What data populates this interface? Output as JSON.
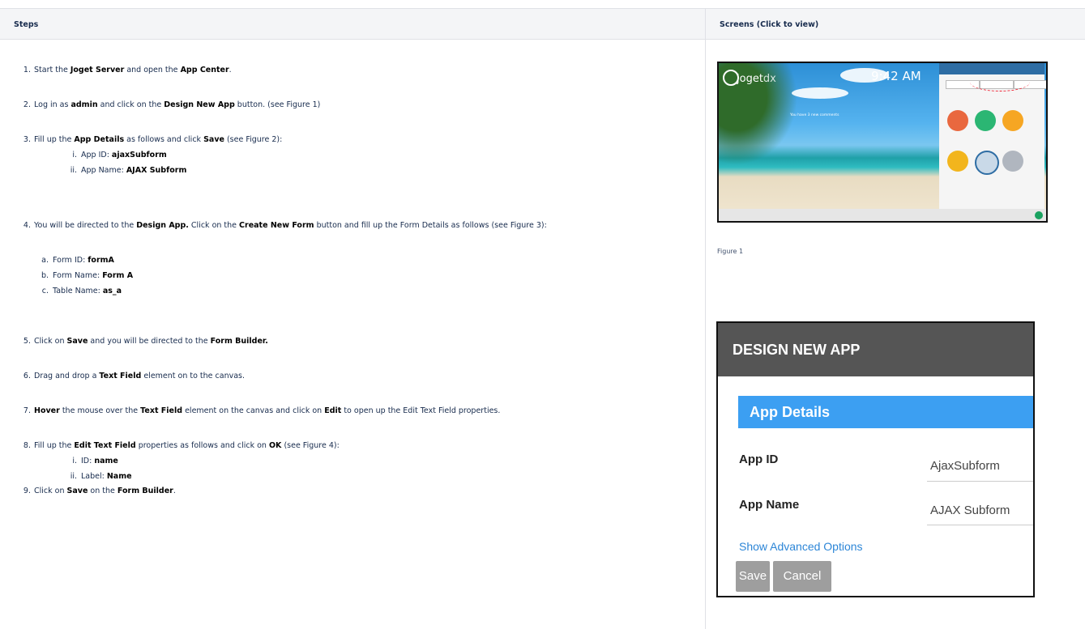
{
  "table": {
    "header_steps": "Steps",
    "header_screens": "Screens (Click to view)"
  },
  "steps": [
    {
      "num": "1.",
      "t1": "Start the ",
      "b1": "Joget Server",
      "t2": " and open the ",
      "b2": "App Center",
      "t3": "."
    },
    {
      "num": "2.",
      "t1": "Log in as ",
      "b1": "admin",
      "t2": " and click on the ",
      "b2": "Design New App",
      "t3": " button. (see Figure 1)"
    },
    {
      "num": "3.",
      "t1": "Fill up the ",
      "b1": "App Details",
      "t2": " as follows and click ",
      "b2": "Save",
      "t3": " (see Figure 2):",
      "subs": [
        {
          "num": "i.",
          "label": "App ID: ",
          "value": "ajaxSubform"
        },
        {
          "num": "ii.",
          "label": "App Name: ",
          "value": "AJAX Subform"
        }
      ]
    },
    {
      "num": "4.",
      "t1": "You will be directed to the ",
      "b1": "Design App.",
      "t2": " Click on the ",
      "b2": "Create New Form",
      "t3": " button and fill up the Form Details as follows (see Figure 3):",
      "subs": [
        {
          "num": "a.",
          "label": "Form ID: ",
          "value": "formA"
        },
        {
          "num": "b.",
          "label": "Form Name: ",
          "value": "Form A"
        },
        {
          "num": "c.",
          "label": "Table Name: ",
          "value": "as_a"
        }
      ]
    },
    {
      "num": "5.",
      "t1": "Click on ",
      "b1": "Save",
      "t2": " and you will be directed to the  ",
      "b2": "Form Builder.",
      "t3": ""
    },
    {
      "num": "6.",
      "t1": "Drag and drop a ",
      "b1": "Text Field",
      "t2": " element on to the canvas.",
      "b2": "",
      "t3": ""
    },
    {
      "num": "7.",
      "b0": "Hover",
      "t1": " the mouse over the ",
      "b1": "Text Field",
      "t2": " element on the canvas and click on ",
      "b2": "Edit",
      "t3": " to open up the Edit Text Field properties."
    },
    {
      "num": "8.",
      "t1": "Fill up the ",
      "b1": "Edit Text Field",
      "t2": "  properties as follows and click on ",
      "b2": "OK",
      "t3": " (see Figure 4):",
      "subs": [
        {
          "num": "i.",
          "label": "ID: ",
          "value": "name"
        },
        {
          "num": "ii.",
          "label": "Label: ",
          "value": "Name"
        }
      ]
    },
    {
      "num": "9.",
      "t1": "Click on ",
      "b1": "Save",
      "t2": " on the ",
      "b2": "Form Builder",
      "t3": "."
    }
  ],
  "figure1": {
    "brand": "joget",
    "brand_suffix": "dx",
    "time": "9:42 AM",
    "message": "You have 3 new comments",
    "caption": "Figure 1"
  },
  "figure2": {
    "header": "DESIGN NEW APP",
    "section": "App Details",
    "app_id_label": "App ID",
    "app_id_value": "AjaxSubform",
    "app_name_label": "App Name",
    "app_name_value": "AJAX Subform",
    "advanced": "Show Advanced Options",
    "save": "Save",
    "cancel": "Cancel"
  },
  "colors": {
    "header_bg": "#f4f5f7",
    "border": "#dfe1e6",
    "dialog_header": "#555555",
    "section_blue": "#3c9ff2",
    "link_blue": "#2d86d7",
    "button_gray": "#9e9e9e"
  }
}
